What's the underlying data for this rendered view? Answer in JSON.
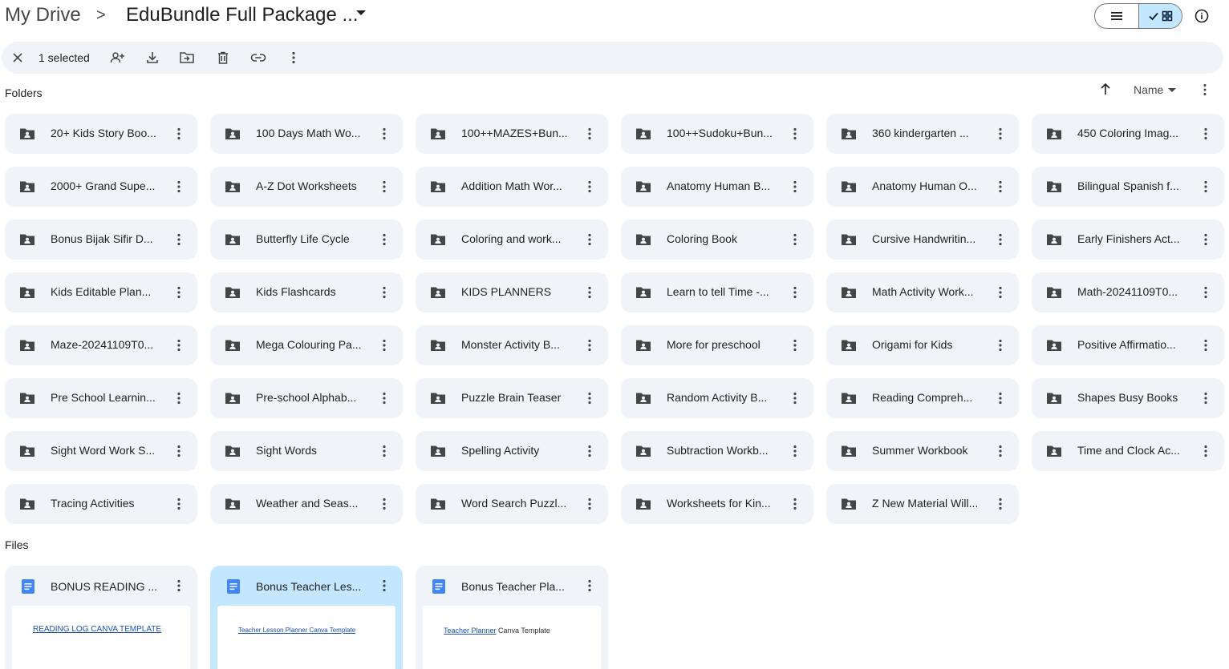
{
  "breadcrumb": {
    "root": "My Drive",
    "separator": ">",
    "current": "EduBundle Full Package ..."
  },
  "view": {
    "mode": "grid"
  },
  "selection_bar": {
    "count_label": "1 selected",
    "actions": [
      "close-icon",
      "share-icon",
      "download-icon",
      "move-icon",
      "trash-icon",
      "link-icon",
      "more-vert-icon"
    ]
  },
  "folders_section": {
    "label": "Folders",
    "sort_label": "Name",
    "sort_direction": "ascending"
  },
  "folders": [
    "20+ Kids Story Boo...",
    "100 Days Math Wo...",
    "100++MAZES+Bun...",
    "100++Sudoku+Bun...",
    "360 kindergarten ...",
    "450 Coloring Imag...",
    "2000+ Grand Supe...",
    "A-Z Dot Worksheets",
    "Addition Math Wor...",
    "Anatomy Human B...",
    "Anatomy Human O...",
    "Bilingual Spanish f...",
    "Bonus Bijak Sifir D...",
    "Butterfly Life Cycle",
    "Coloring and work...",
    "Coloring Book",
    "Cursive Handwritin...",
    "Early Finishers Act...",
    "Kids Editable Plan...",
    "Kids Flashcards",
    "KIDS PLANNERS",
    "Learn to tell Time -...",
    "Math Activity Work...",
    "Math-20241109T0...",
    "Maze-20241109T0...",
    "Mega Colouring Pa...",
    "Monster Activity B...",
    "More for preschool",
    "Origami for Kids",
    "Positive Affirmatio...",
    "Pre School Learnin...",
    "Pre-school Alphab...",
    "Puzzle Brain Teaser",
    "Random Activity B...",
    "Reading Compreh...",
    "Shapes Busy Books",
    "Sight Word Work S...",
    "Sight Words",
    "Spelling Activity",
    "Subtraction Workb...",
    "Summer Workbook",
    "Time and Clock Ac...",
    "Tracing Activities",
    "Weather and Seas...",
    "Word Search Puzzl...",
    "Worksheets for Kin...",
    "Z New Material Will..."
  ],
  "files_section": {
    "label": "Files"
  },
  "files": [
    {
      "name": "BONUS READING ...",
      "selected": false,
      "thumb_text": "READING LOG CANVA TEMPLATE",
      "thumb_plain": ""
    },
    {
      "name": "Bonus Teacher Les...",
      "selected": true,
      "thumb_text": "Teacher Lesson Planner Canva Template",
      "thumb_plain": ""
    },
    {
      "name": "Bonus Teacher Pla...",
      "selected": false,
      "thumb_text": "Teacher Planner",
      "thumb_plain": " Canva Template"
    }
  ],
  "colors": {
    "card_bg": "#f0f4f9",
    "selected_bg": "#c2e7ff",
    "docs_blue": "#4285f4",
    "icon_gray": "#444746"
  }
}
